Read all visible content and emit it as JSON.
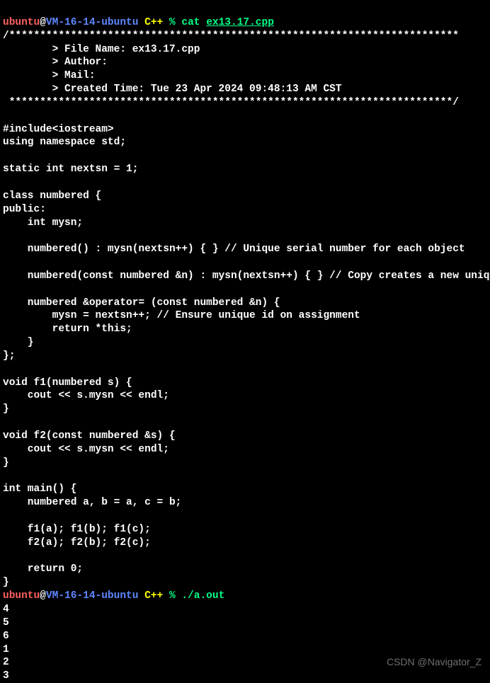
{
  "prompt1": {
    "user": "ubuntu",
    "at": "@",
    "host": "VM-16-14-ubuntu",
    "dir": " C++ ",
    "sep": "% ",
    "cmd": "cat ",
    "arg": "ex13.17.cpp"
  },
  "code": {
    "l01": "/*************************************************************************",
    "l02": "        > File Name: ex13.17.cpp",
    "l03": "        > Author:",
    "l04": "        > Mail:",
    "l05": "        > Created Time: Tue 23 Apr 2024 09:48:13 AM CST",
    "l06": " ************************************************************************/",
    "l07": "",
    "l08": "#include<iostream>",
    "l09": "using namespace std;",
    "l10": "",
    "l11": "static int nextsn = 1;",
    "l12": "",
    "l13": "class numbered {",
    "l14": "public:",
    "l15": "    int mysn;",
    "l16": "",
    "l17": "    numbered() : mysn(nextsn++) { } // Unique serial number for each object",
    "l18": "",
    "l19": "    numbered(const numbered &n) : mysn(nextsn++) { } // Copy creates a new unique id",
    "l20": "",
    "l21": "    numbered &operator= (const numbered &n) {",
    "l22": "        mysn = nextsn++; // Ensure unique id on assignment",
    "l23": "        return *this;",
    "l24": "    }",
    "l25": "};",
    "l26": "",
    "l27": "void f1(numbered s) {",
    "l28": "    cout << s.mysn << endl;",
    "l29": "}",
    "l30": "",
    "l31": "void f2(const numbered &s) {",
    "l32": "    cout << s.mysn << endl;",
    "l33": "}",
    "l34": "",
    "l35": "int main() {",
    "l36": "    numbered a, b = a, c = b;",
    "l37": "",
    "l38": "    f1(a); f1(b); f1(c);",
    "l39": "    f2(a); f2(b); f2(c);",
    "l40": "",
    "l41": "    return 0;",
    "l42": "}"
  },
  "prompt2": {
    "user": "ubuntu",
    "at": "@",
    "host": "VM-16-14-ubuntu",
    "dir": " C++ ",
    "sep": "% ",
    "cmd": "./a.out"
  },
  "output": {
    "o1": "4",
    "o2": "5",
    "o3": "6",
    "o4": "1",
    "o5": "2",
    "o6": "3"
  },
  "watermark": "CSDN @Navigator_Z"
}
